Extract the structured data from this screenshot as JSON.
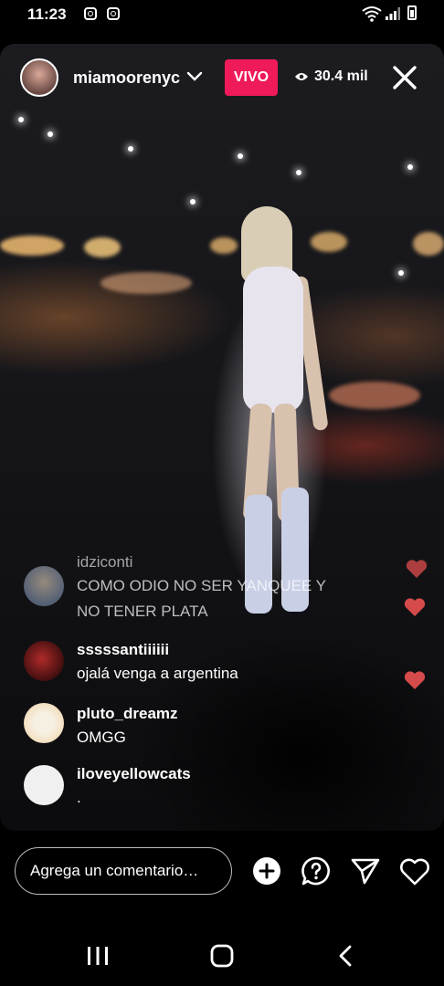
{
  "status_bar": {
    "time": "11:23"
  },
  "header": {
    "username": "miamoorenyc",
    "live_badge": "VIVO",
    "viewer_count": "30.4 mil"
  },
  "comments": [
    {
      "user": "idziconti",
      "text": "COMO ODIO NO SER YANQUEE Y NO TENER PLATA"
    },
    {
      "user": "sssssantiiiiii",
      "text": "ojalá venga a argentina"
    },
    {
      "user": "pluto_dreamz",
      "text": "OMGG"
    },
    {
      "user": "iloveyellowcats",
      "text": "."
    }
  ],
  "footer": {
    "comment_placeholder": "Agrega un comentario…"
  },
  "colors": {
    "live_badge": "#ef1a5a",
    "heart": "#e04848"
  },
  "icons": [
    "instagram-icon",
    "wifi-icon",
    "signal-icon",
    "battery-icon",
    "chevron-down-icon",
    "eye-icon",
    "close-icon",
    "heart-icon",
    "add-icon",
    "question-icon",
    "send-icon",
    "like-icon",
    "recent-apps-icon",
    "home-icon",
    "back-icon"
  ]
}
